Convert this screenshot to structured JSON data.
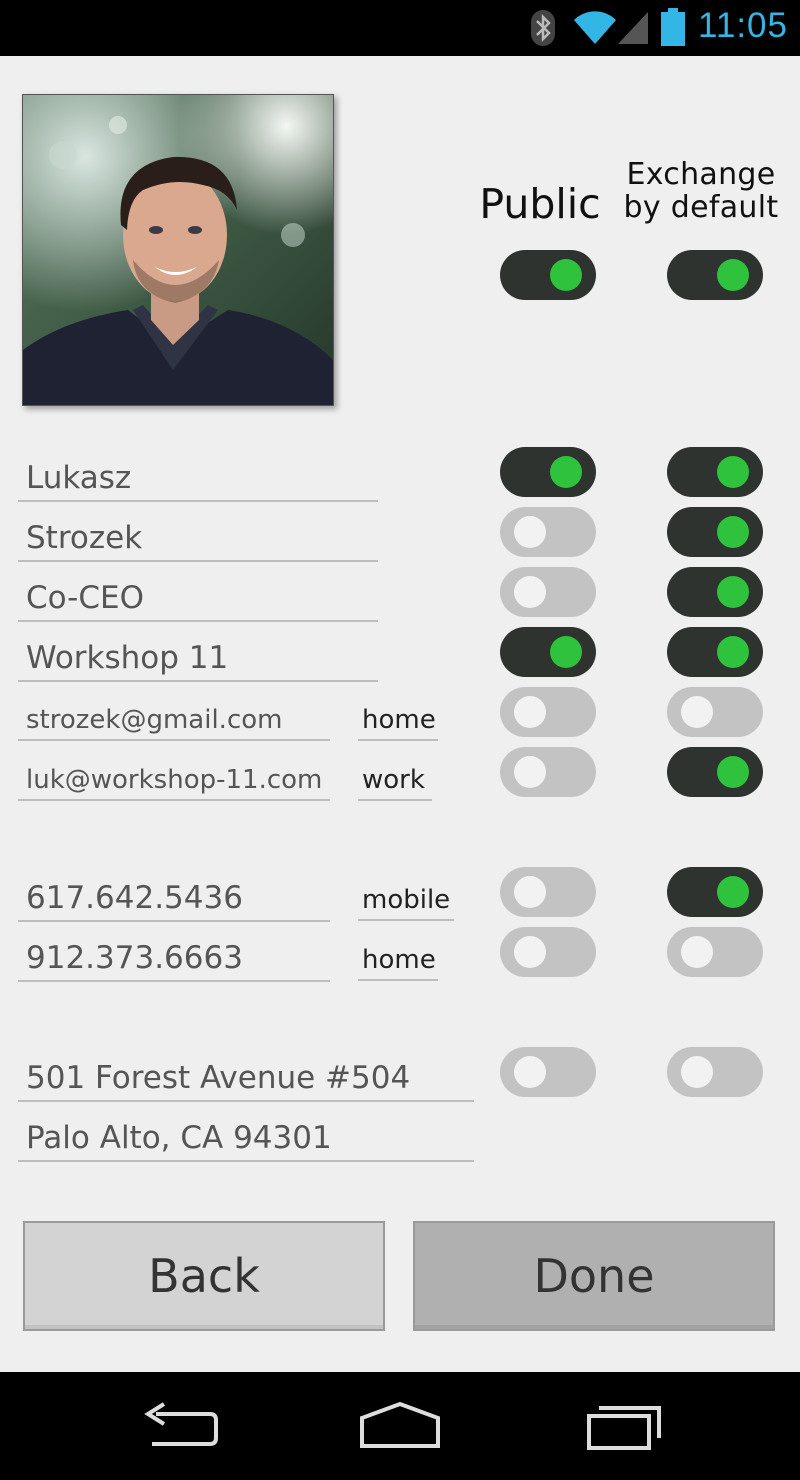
{
  "status_bar": {
    "time": "11:05",
    "icons": [
      "bluetooth-icon",
      "wifi-icon",
      "signal-icon",
      "battery-icon"
    ],
    "accent": "#33b5e5"
  },
  "columns": {
    "public": "Public",
    "exchange_line1": "Exchange",
    "exchange_line2": "by default"
  },
  "header_toggles": {
    "public": true,
    "exchange": true
  },
  "fields": [
    {
      "value": "Lukasz",
      "tag": "",
      "public": true,
      "exchange": true
    },
    {
      "value": "Strozek",
      "tag": "",
      "public": false,
      "exchange": true
    },
    {
      "value": "Co-CEO",
      "tag": "",
      "public": false,
      "exchange": true
    },
    {
      "value": "Workshop 11",
      "tag": "",
      "public": true,
      "exchange": true
    },
    {
      "value": "strozek@gmail.com",
      "tag": "home",
      "public": false,
      "exchange": false
    },
    {
      "value": "luk@workshop-11.com",
      "tag": "work",
      "public": false,
      "exchange": true
    },
    {
      "value": "617.642.5436",
      "tag": "mobile",
      "public": false,
      "exchange": true
    },
    {
      "value": "912.373.6663",
      "tag": "home",
      "public": false,
      "exchange": false
    },
    {
      "value": "501 Forest Avenue #504",
      "tag": "",
      "public": false,
      "exchange": false
    },
    {
      "value": "Palo Alto, CA 94301",
      "tag": ""
    }
  ],
  "buttons": {
    "back": "Back",
    "done": "Done"
  },
  "colors": {
    "toggle_on": "#2f332f",
    "knob_on": "#2ec23d",
    "toggle_off": "#c3c3c3",
    "background": "#efefef"
  }
}
